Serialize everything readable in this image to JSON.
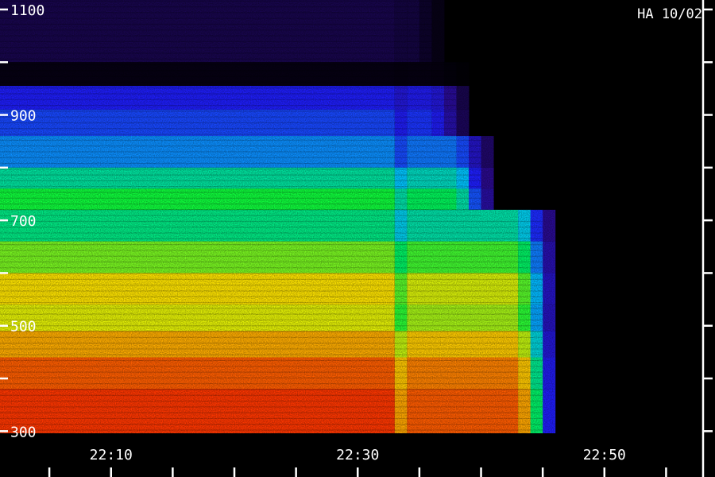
{
  "chart_data": {
    "type": "heatmap",
    "stamp": "HA 10/02",
    "x_ticks": [
      "22:10",
      "22:30",
      "22:50"
    ],
    "y_ticks": [
      "1100",
      "900",
      "700",
      "500",
      "300"
    ],
    "xlim": [
      "22:01",
      "22:58"
    ],
    "ylim": [
      296,
      1118
    ],
    "colormap": [
      "#000000",
      "#2a0a8a",
      "#1f1fff",
      "#00c8ff",
      "#00ff40",
      "#fff000",
      "#ff8000",
      "#ff1000"
    ],
    "bands": [
      {
        "y": [
          1000,
          1118
        ],
        "level": 0.08
      },
      {
        "y": [
          955,
          1000
        ],
        "level": 0.02
      },
      {
        "y": [
          910,
          955
        ],
        "level": 0.28
      },
      {
        "y": [
          860,
          910
        ],
        "level": 0.32
      },
      {
        "y": [
          800,
          860
        ],
        "level": 0.38
      },
      {
        "y": [
          760,
          800
        ],
        "level": 0.5
      },
      {
        "y": [
          720,
          760
        ],
        "level": 0.58
      },
      {
        "y": [
          660,
          720
        ],
        "level": 0.52
      },
      {
        "y": [
          600,
          660
        ],
        "level": 0.64
      },
      {
        "y": [
          540,
          600
        ],
        "level": 0.73
      },
      {
        "y": [
          490,
          540
        ],
        "level": 0.7
      },
      {
        "y": [
          440,
          490
        ],
        "level": 0.8
      },
      {
        "y": [
          380,
          440
        ],
        "level": 0.9
      },
      {
        "y": [
          296,
          380
        ],
        "level": 0.95
      }
    ],
    "edges": [
      {
        "y": [
          1000,
          1118
        ],
        "end": "22:37"
      },
      {
        "y": [
          860,
          1000
        ],
        "end": "22:39"
      },
      {
        "y": [
          700,
          860
        ],
        "end": "22:41"
      },
      {
        "y": [
          296,
          700
        ],
        "end": "22:46"
      }
    ],
    "dip": {
      "x": [
        "22:33",
        "22:34"
      ],
      "factor": 0.85
    }
  }
}
